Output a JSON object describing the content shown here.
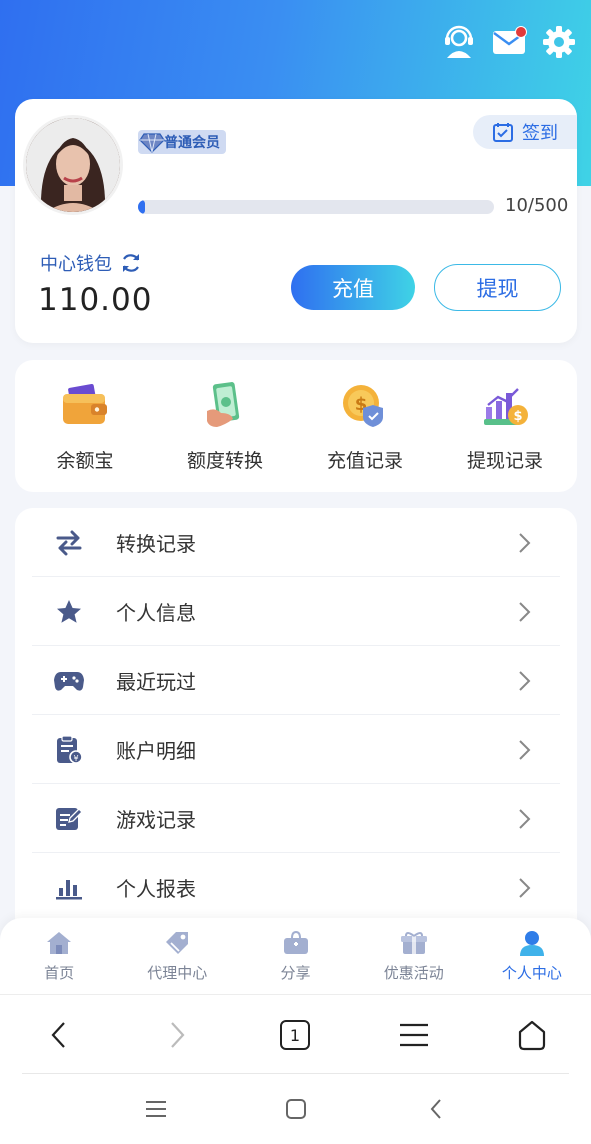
{
  "header": {
    "icons": [
      "customer-service-icon",
      "mail-icon",
      "settings-icon"
    ],
    "has_unread_mail": true
  },
  "profile": {
    "member_level": "普通会员",
    "sign_in_label": "签到",
    "progress_text": "10/500",
    "progress_fraction": 0.02,
    "wallet_label": "中心钱包",
    "wallet_amount": "110.00",
    "recharge_label": "充值",
    "withdraw_label": "提现"
  },
  "quick_actions": [
    {
      "label": "余额宝",
      "icon": "wallet-icon"
    },
    {
      "label": "额度转换",
      "icon": "money-transfer-icon"
    },
    {
      "label": "充值记录",
      "icon": "coin-record-icon"
    },
    {
      "label": "提现记录",
      "icon": "withdraw-chart-icon"
    }
  ],
  "menu": [
    {
      "label": "转换记录",
      "icon": "transfer-icon"
    },
    {
      "label": "个人信息",
      "icon": "star-icon"
    },
    {
      "label": "最近玩过",
      "icon": "gamepad-icon"
    },
    {
      "label": "账户明细",
      "icon": "clipboard-icon"
    },
    {
      "label": "游戏记录",
      "icon": "edit-note-icon"
    },
    {
      "label": "个人报表",
      "icon": "bar-chart-icon"
    }
  ],
  "tabbar": [
    {
      "label": "首页",
      "icon": "home-icon",
      "active": false
    },
    {
      "label": "代理中心",
      "icon": "tag-icon",
      "active": false
    },
    {
      "label": "分享",
      "icon": "share-box-icon",
      "active": false
    },
    {
      "label": "优惠活动",
      "icon": "gift-icon",
      "active": false
    },
    {
      "label": "个人中心",
      "icon": "user-icon",
      "active": true
    }
  ],
  "browser": {
    "tab_count": "1"
  },
  "colors": {
    "accent": "#2c6de4",
    "gradient_start": "#2f6ff0",
    "gradient_end": "#3fd3e6",
    "icon_navy": "#4a5a8a"
  }
}
